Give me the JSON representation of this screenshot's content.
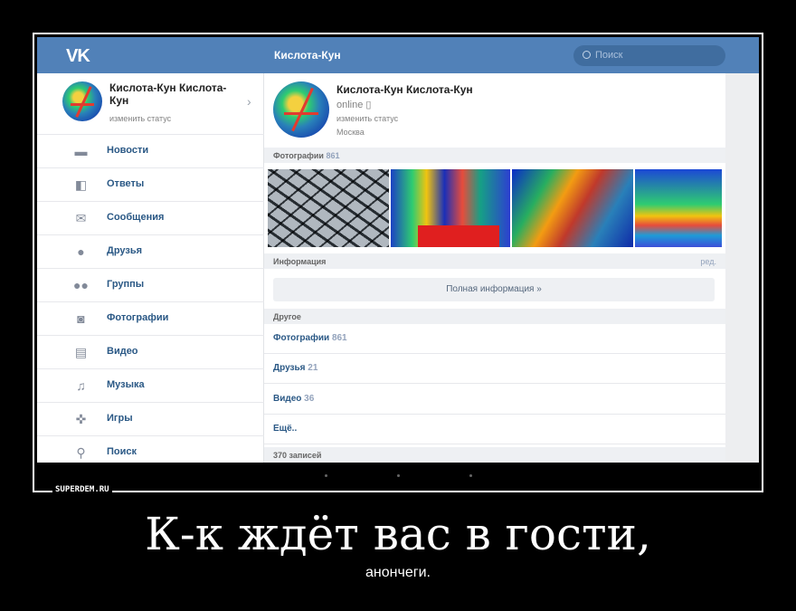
{
  "vk": {
    "logo": "VK",
    "title": "Кислота-Кун",
    "search_placeholder": "Поиск"
  },
  "sidebar": {
    "profile_name": "Кислота-Кун Кислота-Кун",
    "profile_status": "изменить статус",
    "items": [
      {
        "label": "Новости",
        "icon": "news-icon"
      },
      {
        "label": "Ответы",
        "icon": "replies-icon"
      },
      {
        "label": "Сообщения",
        "icon": "mail-icon"
      },
      {
        "label": "Друзья",
        "icon": "person-icon"
      },
      {
        "label": "Группы",
        "icon": "group-icon"
      },
      {
        "label": "Фотографии",
        "icon": "camera-icon"
      },
      {
        "label": "Видео",
        "icon": "film-icon"
      },
      {
        "label": "Музыка",
        "icon": "music-icon"
      },
      {
        "label": "Игры",
        "icon": "gamepad-icon"
      },
      {
        "label": "Поиск",
        "icon": "search-icon"
      }
    ]
  },
  "profile": {
    "name": "Кислота-Кун Кислота-Кун",
    "online": "online",
    "status": "изменить статус",
    "city": "Москва"
  },
  "sections": {
    "photos_label": "Фотографии",
    "photos_count": "861",
    "info_label": "Информация",
    "info_edit": "ред.",
    "full_info": "Полная информация »",
    "other_label": "Другое",
    "posts": "370 записей"
  },
  "other": [
    {
      "label": "Фотографии",
      "count": "861"
    },
    {
      "label": "Друзья",
      "count": "21"
    },
    {
      "label": "Видео",
      "count": "36"
    },
    {
      "label": "Ещё..",
      "count": ""
    }
  ],
  "watermark": "SUPERDEM.RU",
  "caption": "К-к ждёт вас в гости,",
  "subcaption": "анончеги."
}
